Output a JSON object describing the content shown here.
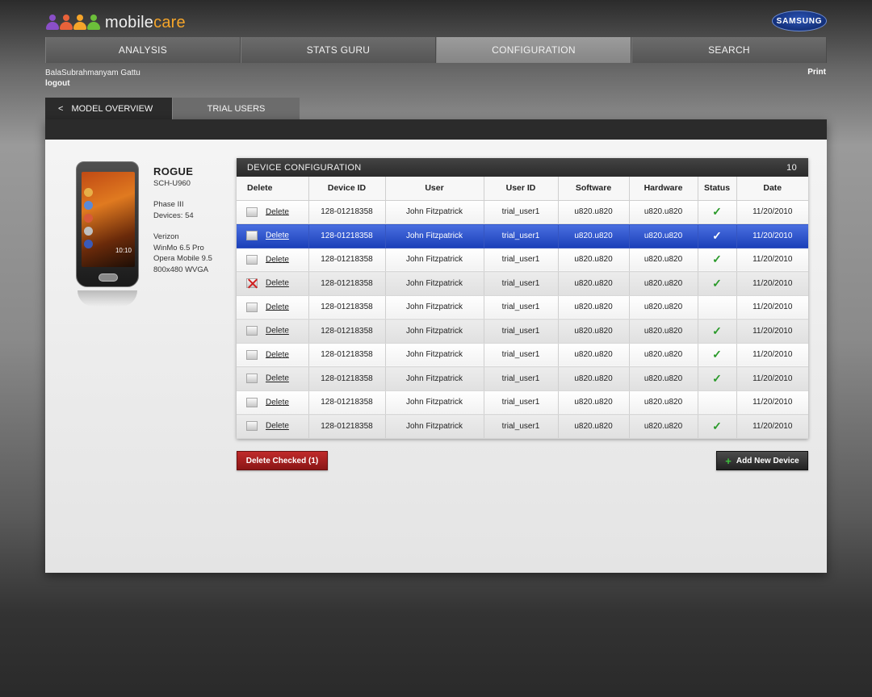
{
  "brand": {
    "logo_text_a": "mobile",
    "logo_text_b": "care",
    "partner": "SAMSUNG",
    "colors": {
      "figure1": "#8a4fc8",
      "figure2": "#e8623a",
      "figure3": "#f5a52a",
      "figure4": "#6cbf3a"
    }
  },
  "nav": [
    {
      "label": "ANALYSIS",
      "active": false
    },
    {
      "label": "STATS GURU",
      "active": false
    },
    {
      "label": "CONFIGURATION",
      "active": true
    },
    {
      "label": "SEARCH",
      "active": false
    }
  ],
  "user": {
    "name": "BalaSubrahmanyam Gattu",
    "logout": "logout",
    "print": "Print"
  },
  "subtabs": [
    {
      "label": "MODEL OVERVIEW",
      "chevron": "<",
      "active": true
    },
    {
      "label": "TRIAL USERS",
      "active": false
    }
  ],
  "device": {
    "name": "ROGUE",
    "model": "SCH-U960",
    "phase": "Phase III",
    "devices": "Devices: 54",
    "carrier": "Verizon",
    "os": "WinMo 6.5 Pro",
    "browser": "Opera Mobile 9.5",
    "resolution": "800x480 WVGA",
    "clock": "10:10"
  },
  "table": {
    "title": "DEVICE CONFIGURATION",
    "count": "10",
    "headers": [
      "Delete",
      "Device ID",
      "User",
      "User ID",
      "Software",
      "Hardware",
      "Status",
      "Date"
    ],
    "rows": [
      {
        "checked": false,
        "selected": false,
        "delete": "Delete",
        "device_id": "128-01218358",
        "user": "John Fitzpatrick",
        "user_id": "trial_user1",
        "software": "u820.u820",
        "hardware": "u820.u820",
        "status": "✓",
        "date": "11/20/2010"
      },
      {
        "checked": false,
        "selected": true,
        "delete": "Delete",
        "device_id": "128-01218358",
        "user": "John Fitzpatrick",
        "user_id": "trial_user1",
        "software": "u820.u820",
        "hardware": "u820.u820",
        "status": "✓",
        "date": "11/20/2010"
      },
      {
        "checked": false,
        "selected": false,
        "delete": "Delete",
        "device_id": "128-01218358",
        "user": "John Fitzpatrick",
        "user_id": "trial_user1",
        "software": "u820.u820",
        "hardware": "u820.u820",
        "status": "✓",
        "date": "11/20/2010"
      },
      {
        "checked": true,
        "selected": false,
        "delete": "Delete",
        "device_id": "128-01218358",
        "user": "John Fitzpatrick",
        "user_id": "trial_user1",
        "software": "u820.u820",
        "hardware": "u820.u820",
        "status": "✓",
        "date": "11/20/2010"
      },
      {
        "checked": false,
        "selected": false,
        "delete": "Delete",
        "device_id": "128-01218358",
        "user": "John Fitzpatrick",
        "user_id": "trial_user1",
        "software": "u820.u820",
        "hardware": "u820.u820",
        "status": "",
        "date": "11/20/2010"
      },
      {
        "checked": false,
        "selected": false,
        "delete": "Delete",
        "device_id": "128-01218358",
        "user": "John Fitzpatrick",
        "user_id": "trial_user1",
        "software": "u820.u820",
        "hardware": "u820.u820",
        "status": "✓",
        "date": "11/20/2010"
      },
      {
        "checked": false,
        "selected": false,
        "delete": "Delete",
        "device_id": "128-01218358",
        "user": "John Fitzpatrick",
        "user_id": "trial_user1",
        "software": "u820.u820",
        "hardware": "u820.u820",
        "status": "✓",
        "date": "11/20/2010"
      },
      {
        "checked": false,
        "selected": false,
        "delete": "Delete",
        "device_id": "128-01218358",
        "user": "John Fitzpatrick",
        "user_id": "trial_user1",
        "software": "u820.u820",
        "hardware": "u820.u820",
        "status": "✓",
        "date": "11/20/2010"
      },
      {
        "checked": false,
        "selected": false,
        "delete": "Delete",
        "device_id": "128-01218358",
        "user": "John Fitzpatrick",
        "user_id": "trial_user1",
        "software": "u820.u820",
        "hardware": "u820.u820",
        "status": "",
        "date": "11/20/2010"
      },
      {
        "checked": false,
        "selected": false,
        "delete": "Delete",
        "device_id": "128-01218358",
        "user": "John Fitzpatrick",
        "user_id": "trial_user1",
        "software": "u820.u820",
        "hardware": "u820.u820",
        "status": "✓",
        "date": "11/20/2010"
      }
    ]
  },
  "actions": {
    "delete_checked": "Delete Checked (1)",
    "add_plus": "+",
    "add_new": "Add New Device"
  }
}
